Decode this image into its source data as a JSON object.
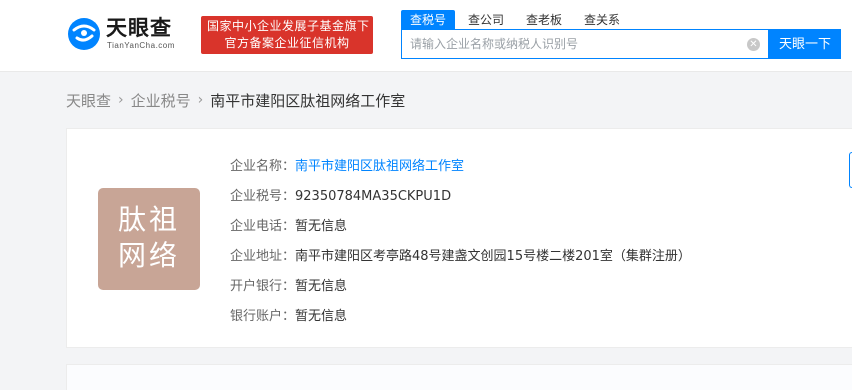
{
  "brand": {
    "name": "天眼查",
    "sub": "TianYanCha.com",
    "color": "#0084ff"
  },
  "badge": {
    "line1": "国家中小企业发展子基金旗下",
    "line2": "官方备案企业征信机构",
    "color": "#d9342b"
  },
  "search": {
    "tabs": [
      {
        "label": "查税号",
        "active": true
      },
      {
        "label": "查公司",
        "active": false
      },
      {
        "label": "查老板",
        "active": false
      },
      {
        "label": "查关系",
        "active": false
      }
    ],
    "placeholder": "请输入企业名称或纳税人识别号",
    "value": "",
    "button": "天眼一下"
  },
  "breadcrumb": {
    "items": [
      "天眼查",
      "企业税号"
    ],
    "current": "南平市建阳区肽祖网络工作室"
  },
  "company": {
    "avatar": {
      "line1": "肽祖",
      "line2": "网络",
      "color": "#c8a596"
    },
    "fields": [
      {
        "label": "企业名称：",
        "value": "南平市建阳区肽祖网络工作室",
        "link": true
      },
      {
        "label": "企业税号：",
        "value": "92350784MA35CKPU1D",
        "link": false
      },
      {
        "label": "企业电话：",
        "value": "暂无信息",
        "link": false
      },
      {
        "label": "企业地址：",
        "value": "南平市建阳区考亭路48号建盏文创园15号楼二楼201室（集群注册）",
        "link": false
      },
      {
        "label": "开户银行：",
        "value": "暂无信息",
        "link": false
      },
      {
        "label": "银行账户：",
        "value": "暂无信息",
        "link": false
      }
    ]
  }
}
